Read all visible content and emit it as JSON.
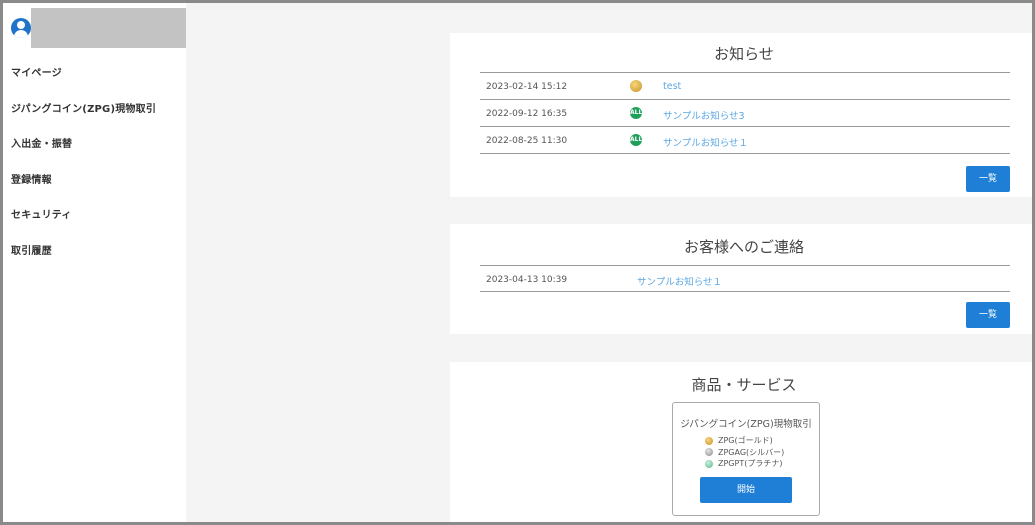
{
  "sidebar": {
    "nav": [
      {
        "label": "マイページ"
      },
      {
        "label": "ジパングコイン(ZPG)現物取引"
      },
      {
        "label": "入出金・振替"
      },
      {
        "label": "登録情報"
      },
      {
        "label": "セキュリティ"
      },
      {
        "label": "取引履歴"
      }
    ]
  },
  "notices": {
    "title": "お知らせ",
    "rows": [
      {
        "date": "2023-02-14 15:12",
        "icon": "zpg-gold-coin-icon",
        "title": "test"
      },
      {
        "date": "2022-09-12 16:35",
        "icon": "all-badge-icon",
        "badge": "ALL",
        "title": "サンプルお知らせ3"
      },
      {
        "date": "2022-08-25 11:30",
        "icon": "all-badge-icon",
        "badge": "ALL",
        "title": "サンプルお知らせ１"
      }
    ],
    "list_button": "一覧"
  },
  "messages": {
    "title": "お客様へのご連絡",
    "rows": [
      {
        "date": "2023-04-13 10:39",
        "title": "サンプルお知らせ１"
      }
    ],
    "list_button": "一覧"
  },
  "products": {
    "title": "商品・サービス",
    "card": {
      "name": "ジパングコイン(ZPG)現物取引",
      "coins": [
        {
          "label": "ZPG(ゴールド)",
          "icon": "gold-coin-icon"
        },
        {
          "label": "ZPGAG(シルバー)",
          "icon": "silver-coin-icon"
        },
        {
          "label": "ZPGPT(プラチナ)",
          "icon": "platinum-coin-icon"
        }
      ],
      "start_button": "開始"
    }
  },
  "colors": {
    "accent": "#1f7fd6",
    "link": "#5aa7e3",
    "badge_green": "#1ea05a",
    "background": "#f4f4f4"
  }
}
